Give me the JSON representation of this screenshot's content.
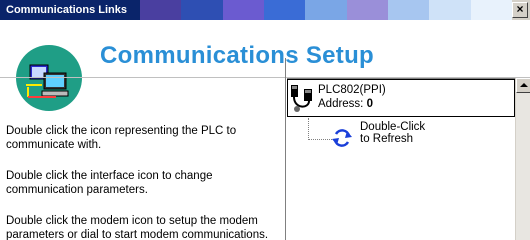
{
  "window": {
    "title": "Communications Links",
    "close_glyph": "×",
    "titlebar_colors": [
      "#4a3fa0",
      "#2e4fb3",
      "#6b5bd0",
      "#3a6cd6",
      "#7aa6e6",
      "#9a8fd9",
      "#a7c6f0",
      "#cfe2f8",
      "#e8f2fc"
    ]
  },
  "header": {
    "title": "Communications Setup",
    "logo_icon": "network-pc-icon",
    "accent": "#2a8fd6",
    "logo_bg": "#1f9e86"
  },
  "help": {
    "p1": "Double click the icon representing the PLC to communicate with.",
    "p2": "Double click the interface icon to change communication parameters.",
    "p3": "Double click the modem icon to setup the modem parameters or dial to start modem communications."
  },
  "tree": {
    "plc_name": "PLC802(PPI)",
    "address_label": "Address:",
    "address_value": "0",
    "plc_icon": "plc-icon",
    "refresh_icon": "refresh-icon",
    "refresh_line1": "Double-Click",
    "refresh_line2": "to Refresh"
  }
}
